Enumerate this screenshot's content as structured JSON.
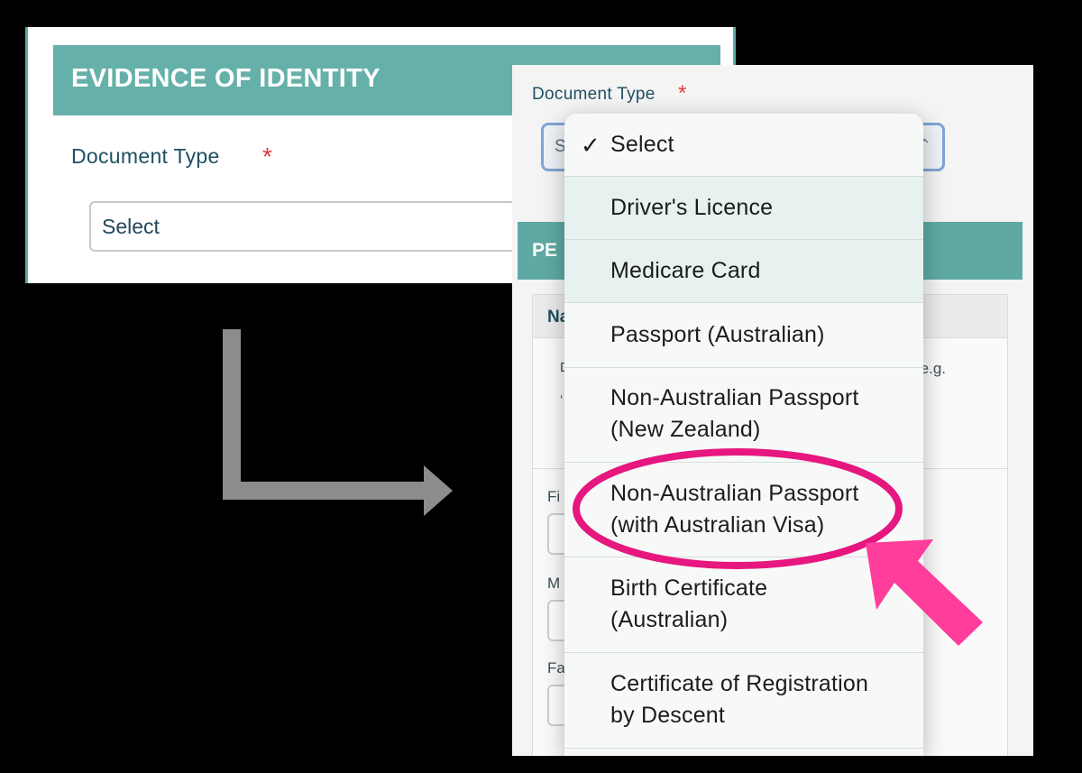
{
  "left": {
    "section_title": "EVIDENCE OF IDENTITY",
    "field_label": "Document Type",
    "required_marker": "*",
    "select_value": "Select"
  },
  "right": {
    "field_label": "Document Type",
    "required_marker": "*",
    "select_value": "S",
    "caret": "⌃",
    "section_title_partial": "PE",
    "card_title_partial": "Na",
    "hint_tail": "e.g.",
    "hint_left_1": "D",
    "hint_left_2": "‘",
    "fields": [
      "Fi",
      "M",
      "Fa"
    ]
  },
  "dropdown": {
    "check_glyph": "✓",
    "options": [
      {
        "line1": "Select",
        "line2": "",
        "selected": true
      },
      {
        "line1": "Driver's Licence",
        "line2": ""
      },
      {
        "line1": "Medicare Card",
        "line2": ""
      },
      {
        "line1": "Passport (Australian)",
        "line2": ""
      },
      {
        "line1": "Non-Australian Passport",
        "line2": "(New Zealand)"
      },
      {
        "line1": "Non-Australian Passport",
        "line2": "(with Australian Visa)",
        "highlighted": true
      },
      {
        "line1": "Birth Certificate",
        "line2": "(Australian)"
      },
      {
        "line1": "Certificate of Registration",
        "line2": "by Descent"
      }
    ]
  },
  "annotation": {
    "highlight_color": "#e6177f",
    "arrow_color": "#ff3d9a",
    "connector_color": "#8c8c8c"
  }
}
